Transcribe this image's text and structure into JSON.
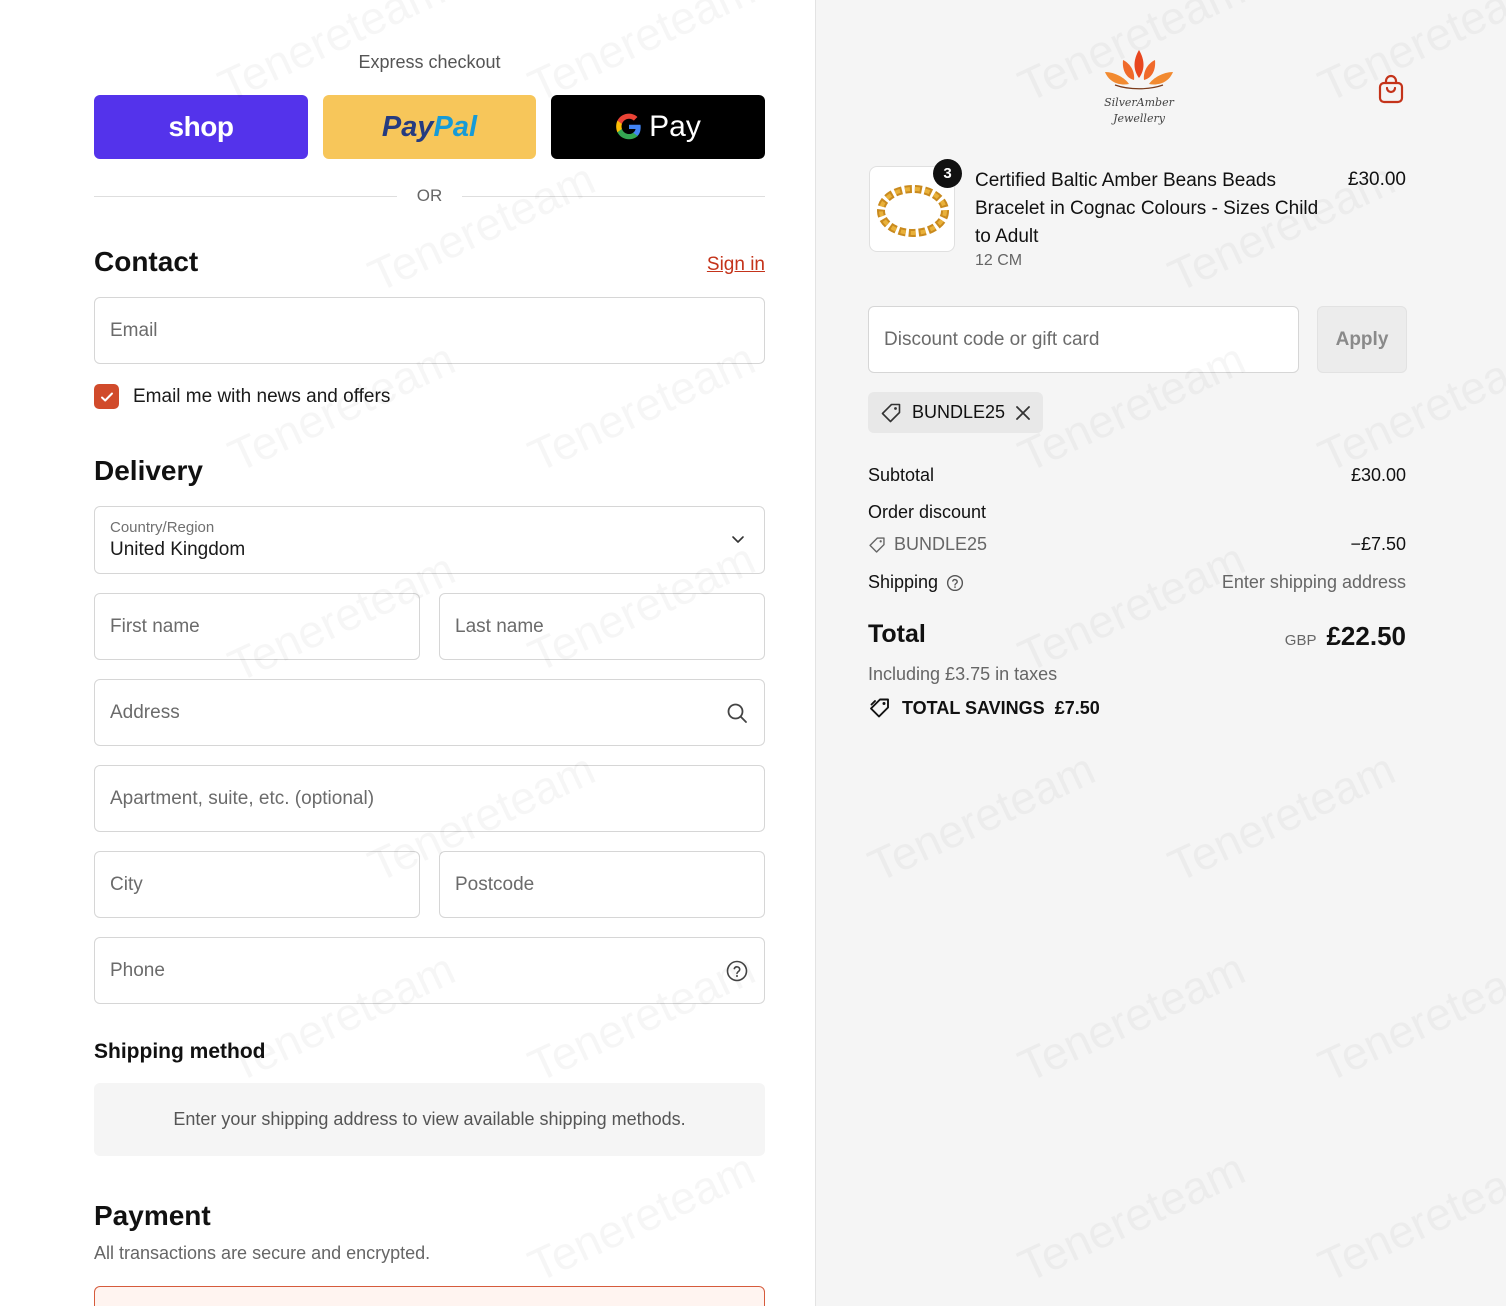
{
  "express": {
    "title": "Express checkout",
    "shop_label": "shop",
    "paypal_label_1": "Pay",
    "paypal_label_2": "Pal",
    "gpay_label": "Pay",
    "or_label": "OR"
  },
  "contact": {
    "heading": "Contact",
    "sign_in": "Sign in",
    "email_placeholder": "Email",
    "newsletter_label": "Email me with news and offers",
    "newsletter_checked": true
  },
  "delivery": {
    "heading": "Delivery",
    "country_label": "Country/Region",
    "country_value": "United Kingdom",
    "first_name_placeholder": "First name",
    "last_name_placeholder": "Last name",
    "address_placeholder": "Address",
    "apartment_placeholder": "Apartment, suite, etc. (optional)",
    "city_placeholder": "City",
    "postcode_placeholder": "Postcode",
    "phone_placeholder": "Phone"
  },
  "shipping_method": {
    "heading": "Shipping method",
    "message": "Enter your shipping address to view available shipping methods."
  },
  "payment": {
    "heading": "Payment",
    "subtitle": "All transactions are secure and encrypted."
  },
  "store": {
    "logo_line1": "SilverAmber",
    "logo_line2": "Jewellery"
  },
  "order": {
    "item": {
      "quantity": "3",
      "title": "Certified Baltic Amber Beans Beads Bracelet in Cognac Colours - Sizes Child to Adult",
      "variant": "12 CM",
      "price": "£30.00"
    },
    "discount_placeholder": "Discount code or gift card",
    "apply_label": "Apply",
    "applied_code": "BUNDLE25",
    "subtotal_label": "Subtotal",
    "subtotal_value": "£30.00",
    "order_discount_label": "Order discount",
    "discount_code": "BUNDLE25",
    "discount_value": "−£7.50",
    "shipping_label": "Shipping",
    "shipping_value": "Enter shipping address",
    "total_label": "Total",
    "currency": "GBP",
    "total_value": "£22.50",
    "taxes_note": "Including £3.75 in taxes",
    "savings_label": "TOTAL SAVINGS",
    "savings_value": "£7.50"
  },
  "watermark": "Tenereteam",
  "colors": {
    "accent": "#c4331a",
    "shop": "#5433eb",
    "paypal": "#f7c65a",
    "gpay": "#000000",
    "checkbox": "#d14b2b"
  }
}
